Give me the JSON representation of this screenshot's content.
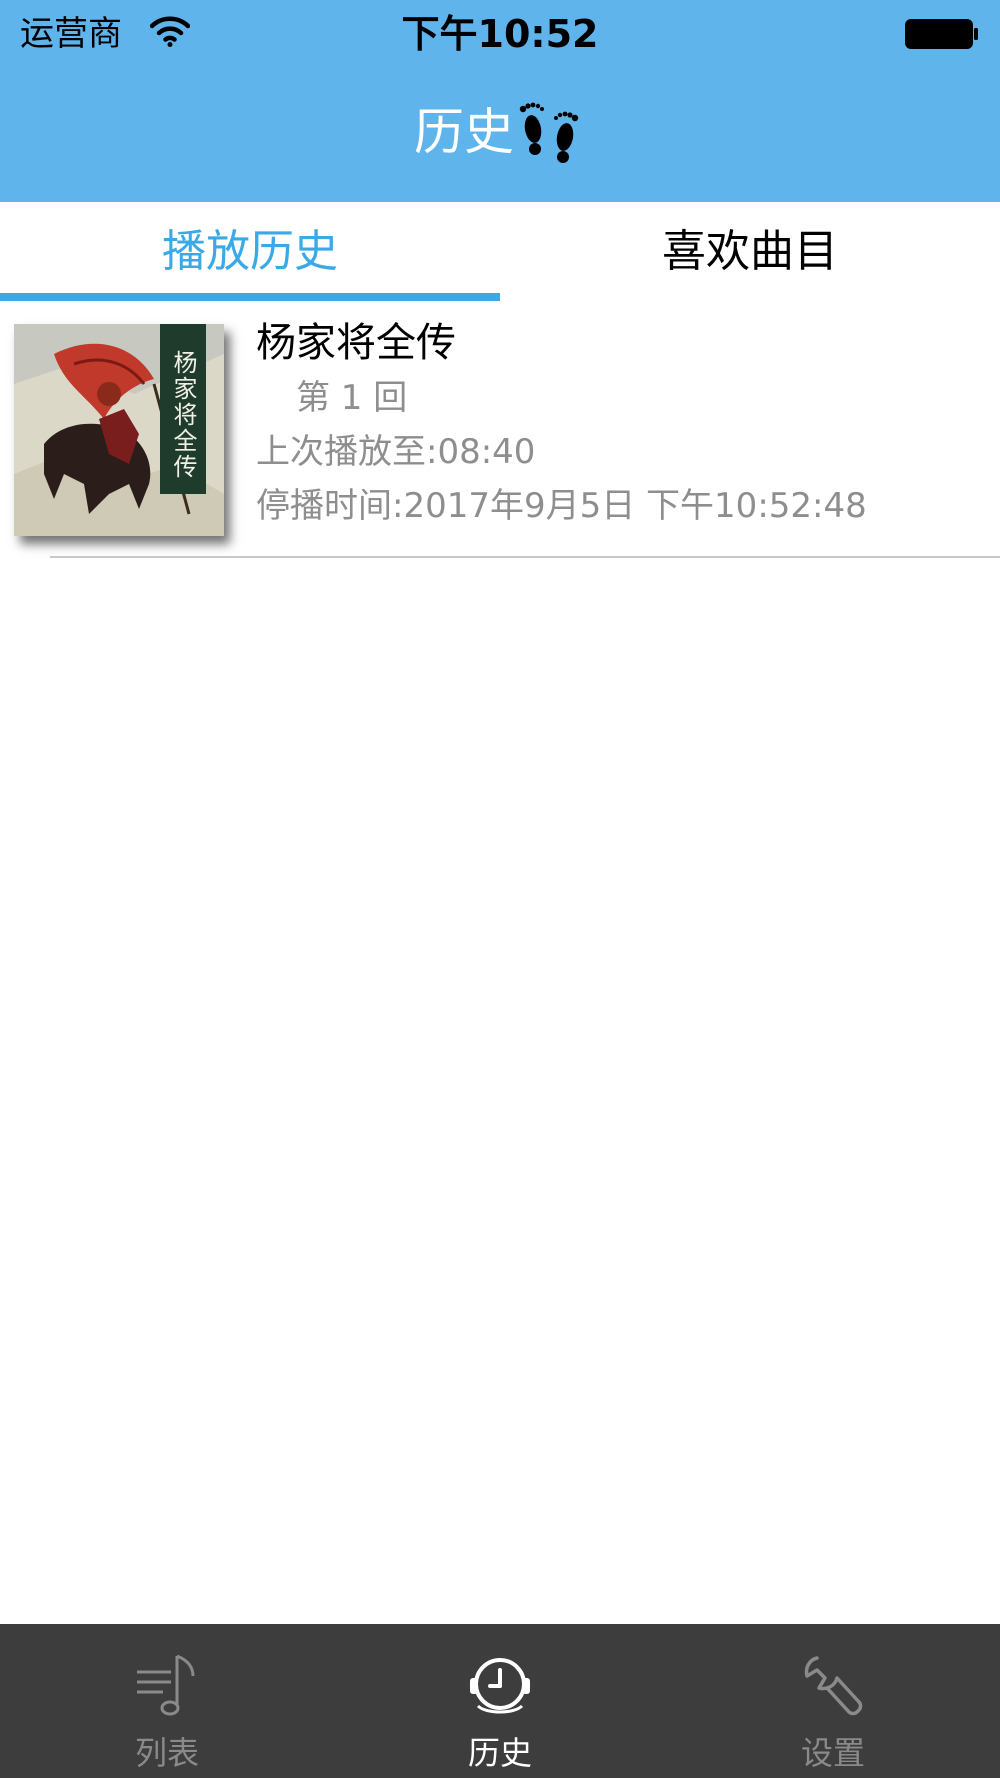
{
  "status_bar": {
    "carrier": "运营商",
    "time": "下午10:52"
  },
  "nav": {
    "title": "历史",
    "title_icon": "footprints-icon"
  },
  "tabs": [
    {
      "label": "播放历史",
      "selected": true
    },
    {
      "label": "喜欢曲目",
      "selected": false
    }
  ],
  "history": [
    {
      "title": "杨家将全传",
      "episode": "第 1 回",
      "last_position": "上次播放至:08:40",
      "stopped_at": "停播时间:2017年9月5日 下午10:52:48",
      "cover_text": "杨家将全传"
    }
  ],
  "tabbar": {
    "items": [
      {
        "label": "列表",
        "icon": "music-list-icon",
        "selected": false
      },
      {
        "label": "历史",
        "icon": "clock-headset-icon",
        "selected": true
      },
      {
        "label": "设置",
        "icon": "wrench-icon",
        "selected": false
      }
    ]
  },
  "colors": {
    "nav_background": "#5fb4ec",
    "accent": "#3aa9e6",
    "tabbar_background": "#3d3d3d",
    "secondary_text": "#8e8e8e"
  }
}
